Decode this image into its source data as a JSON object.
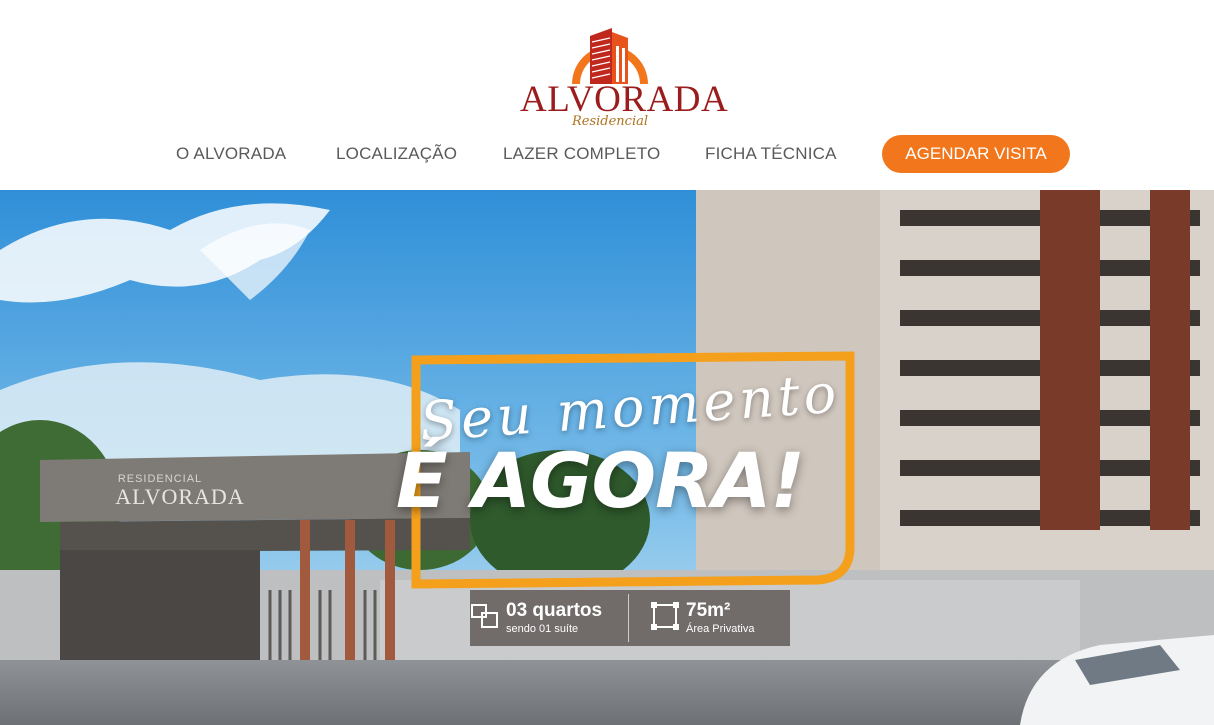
{
  "logo": {
    "name": "ALVORADA",
    "tagline": "Residencial"
  },
  "nav": {
    "items": [
      "O ALVORADA",
      "LOCALIZAÇÃO",
      "LAZER COMPLETO",
      "FICHA TÉCNICA"
    ],
    "cta": "AGENDAR VISITA"
  },
  "hero": {
    "script_line": "Seu momento",
    "headline": "É AGORA!",
    "gate_sign_small": "RESIDENCIAL",
    "gate_sign_big": "ALVORADA",
    "features": [
      {
        "icon": "rooms-icon",
        "title": "03 quartos",
        "subtitle": "sendo 01 suíte"
      },
      {
        "icon": "area-icon",
        "title": "75m²",
        "subtitle": "Área Privativa"
      }
    ]
  },
  "colors": {
    "accent_orange": "#f2761c",
    "brand_red": "#9b1c1c",
    "frame_orange": "#f4a01c"
  }
}
